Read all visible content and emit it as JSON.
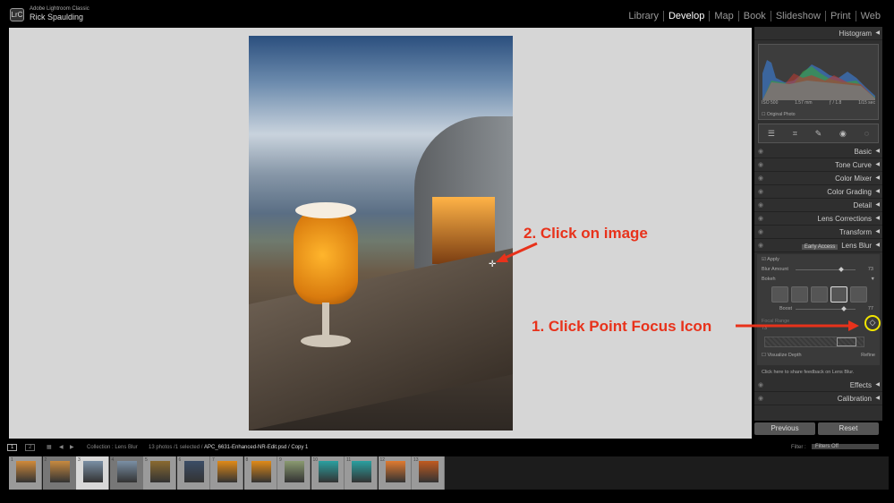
{
  "app": {
    "logo": "LrC",
    "product": "Adobe Lightroom Classic",
    "user": "Rick Spaulding"
  },
  "modules": [
    {
      "label": "Library"
    },
    {
      "label": "Develop",
      "active": true
    },
    {
      "label": "Map"
    },
    {
      "label": "Book"
    },
    {
      "label": "Slideshow"
    },
    {
      "label": "Print"
    },
    {
      "label": "Web"
    }
  ],
  "annotations": {
    "click_image": "2. Click on image",
    "click_focus": "1. Click Point Focus Icon",
    "color": "#e8321b"
  },
  "histogram": {
    "title": "Histogram",
    "iso": "ISO 500",
    "focal": "1.57 mm",
    "aperture": "ƒ / 1.8",
    "shutter": "1/15 sec",
    "original_photo": "Original Photo"
  },
  "panels": {
    "basic": "Basic",
    "tone_curve": "Tone Curve",
    "color_mixer": "Color Mixer",
    "color_grading": "Color Grading",
    "detail": "Detail",
    "lens_corrections": "Lens Corrections",
    "transform": "Transform",
    "lens_blur": "Lens Blur",
    "early_access": "Early Access",
    "effects": "Effects",
    "calibration": "Calibration"
  },
  "lens_blur": {
    "apply": "Apply",
    "blur_amount_label": "Blur Amount",
    "blur_amount": 73,
    "bokeh": "Bokeh",
    "boost_label": "Boost",
    "boost": 77,
    "focal_range_label": "Focal Range",
    "focal_range": 73,
    "visualize_depth": "Visualize Depth",
    "refine": "Refine",
    "feedback": "Click here to share feedback on Lens Blur."
  },
  "buttons": {
    "previous": "Previous",
    "reset": "Reset"
  },
  "filmstrip_bar": {
    "view1": "1",
    "view2": "2",
    "collection": "Collection : Lens Blur",
    "count": "13 photos /1 selected /",
    "filename": "APC_6631-Enhanced-NR-Edit.psd / Copy 1",
    "filter_label": "Filter :",
    "filter_value": "Filters Off"
  },
  "thumbnails": [
    {
      "n": "1",
      "c": "#d08a3a"
    },
    {
      "n": "2",
      "c": "#c88a40"
    },
    {
      "n": "3",
      "c": "#7a8fa5"
    },
    {
      "n": "4",
      "c": "#7a8fa5"
    },
    {
      "n": "5",
      "c": "#8a6a30"
    },
    {
      "n": "6",
      "c": "#3b4d66"
    },
    {
      "n": "7",
      "c": "#e08a18"
    },
    {
      "n": "8",
      "c": "#e08a18"
    },
    {
      "n": "9",
      "c": "#8a9a70"
    },
    {
      "n": "10",
      "c": "#2aa0a0"
    },
    {
      "n": "11",
      "c": "#2aa0a0"
    },
    {
      "n": "12",
      "c": "#e07a30"
    },
    {
      "n": "13",
      "c": "#c05a20"
    }
  ]
}
